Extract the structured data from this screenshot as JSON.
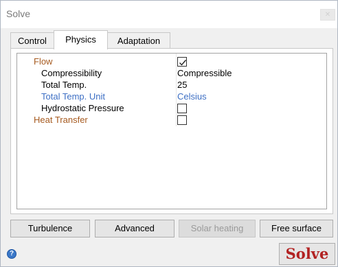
{
  "window": {
    "title": "Solve"
  },
  "tabs": [
    {
      "label": "Control",
      "active": false
    },
    {
      "label": "Physics",
      "active": true
    },
    {
      "label": "Adaptation",
      "active": false
    }
  ],
  "properties": [
    {
      "name": "Flow",
      "value": "",
      "checkbox": true,
      "checked": true
    },
    {
      "name": "Compressibility",
      "value": "Compressible",
      "checkbox": false
    },
    {
      "name": "Total Temp.",
      "value": "25",
      "checkbox": false
    },
    {
      "name": "Total Temp. Unit",
      "value": "Celsius",
      "checkbox": false
    },
    {
      "name": "Hydrostatic Pressure",
      "value": "",
      "checkbox": true,
      "checked": false
    },
    {
      "name": "Heat Transfer",
      "value": "",
      "checkbox": true,
      "checked": false
    }
  ],
  "buttons": {
    "turbulence": "Turbulence",
    "advanced": "Advanced",
    "solar_heating": "Solar heating",
    "free_surface": "Free surface"
  },
  "solve_label": "Solve",
  "help_icon": "help-icon",
  "colors": {
    "category": "#a65a1f",
    "link_value": "#3d6fc4",
    "solve": "#b22222"
  }
}
